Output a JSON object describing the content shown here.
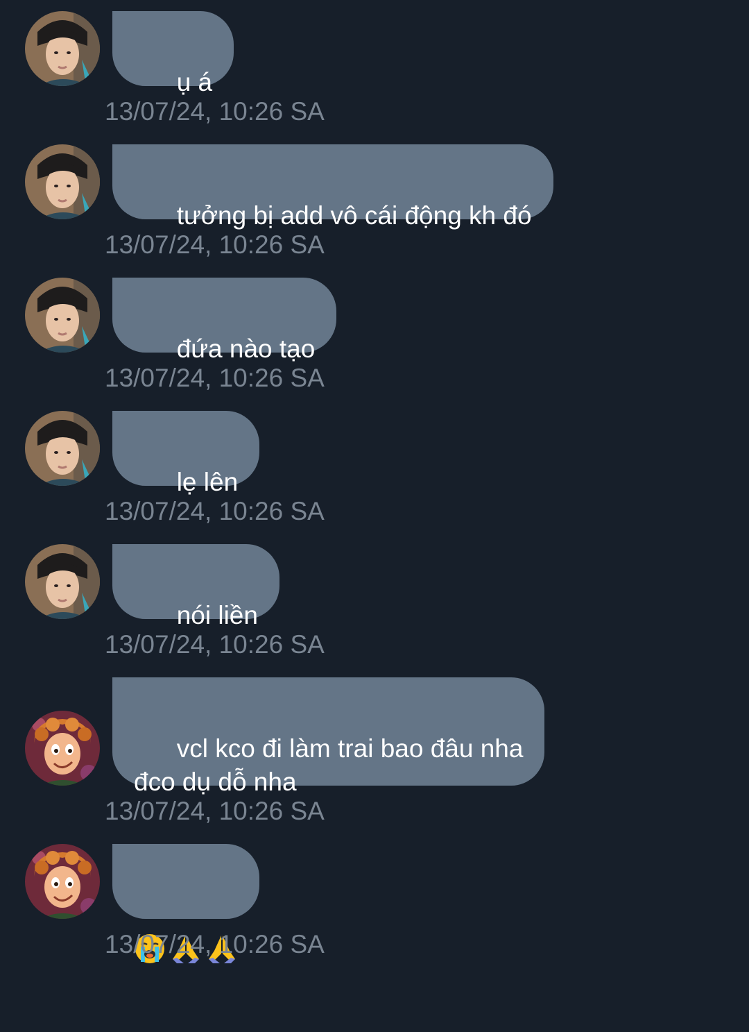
{
  "messages": [
    {
      "text": "ụ á",
      "timestamp": "13/07/24, 10:26 SA",
      "sender_avatar": "avatar-young-man"
    },
    {
      "text": "tưởng bị add vô cái động kh đó",
      "timestamp": "13/07/24, 10:26 SA",
      "sender_avatar": "avatar-young-man"
    },
    {
      "text": "đứa nào tạo",
      "timestamp": "13/07/24, 10:26 SA",
      "sender_avatar": "avatar-young-man"
    },
    {
      "text": "lẹ lên",
      "timestamp": "13/07/24, 10:26 SA",
      "sender_avatar": "avatar-young-man"
    },
    {
      "text": "nói liền",
      "timestamp": "13/07/24, 10:26 SA",
      "sender_avatar": "avatar-young-man"
    },
    {
      "text": "vcl kco đi làm trai bao đâu nha\nđco dụ dỗ nha",
      "timestamp": "13/07/24, 10:26 SA",
      "sender_avatar": "avatar-cartoon-character"
    },
    {
      "emojis": [
        "loudly-crying-face-icon",
        "folded-hands-icon",
        "folded-hands-icon"
      ],
      "timestamp": "13/07/24, 10:26 SA",
      "sender_avatar": "avatar-cartoon-character"
    }
  ],
  "colors": {
    "background": "#171f2a",
    "bubble": "#647587",
    "bubble_text": "#ffffff",
    "timestamp": "#7a8592"
  }
}
